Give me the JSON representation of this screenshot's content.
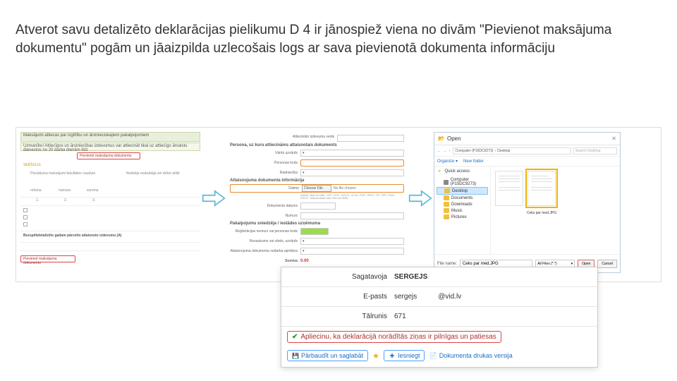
{
  "heading": "Atverot savu detalizēto deklarācijas pielikumu D 4 ir jānospiež viena no divām \"Pievienot maksājuma dokumentu\" pogām un jāaizpilda uzlecošais logs ar sava pievienotā dokumenta informāciju",
  "panel1": {
    "bar1": "Maksājumi attiecas par izglītību un ārstnieciskajiem pakalpojumiem",
    "bar2": "Uzmanību! Attiecīgos un ārstniecības izdevumus var attiecināt tikai uz attiecīgo ārvalstu dienestos no 20 darba dienām līdz",
    "redbox1": "Pievienot maksājuma dokumentu",
    "redbox2": "Pievienot maksājuma dokumentu",
    "rowhdr": "SERŠULIS",
    "cols": [
      "1.",
      "2.",
      "3."
    ],
    "lbl_pieliekami": "Piesiātuma maksājumi fakultātes naudula",
    "lbl_nedekamja": "Nodokļa maksātāja vel drīkst atlikt",
    "lbl_refuma": "refuma",
    "lbl_numura": "numura",
    "lbl_summa": "summa",
    "sec2": "Bezspēkdetalizēts gadam pārcelto attaisnoto izdevumu (A)"
  },
  "panel2": {
    "hdr_right": "Attiecināto izdevumu veids",
    "hdr1": "Persona, uz kuru attiecināms attaisnotais dokuments",
    "lbl_vards": "Vārds uzvārds",
    "lbl_pk": "Personas kods",
    "lbl_rad": "Radniecība",
    "hdr2": "Attaisnojuma dokumenta informācija",
    "lbl_date": "Datme",
    "choose": "Choose File",
    "nofile": "No file chosen",
    "hint": "Atļauto failu formāti: ODT, DOC, DOCX, XLSX, PDF, JPEG, TIF, TIFF, PNG, EDOC. Maksimālais failu lielums 5MB.",
    "lbl_dokdate": "Dokumenta datums",
    "lbl_num": "Numurs",
    "hdr3": "Pakalpojumu sniedzēja / iestādes uzņēmuma",
    "lbl_reg": "Reģistrācijas numurs vai personas kods",
    "lbl_name": "Nosaukums vai vārds, uzvārds",
    "lbl_sum": "Attaisnojuma dokumenta nodarba aprēķina",
    "lbl_summa": "Summa",
    "val_zero": "0.00",
    "outline_personas": true
  },
  "panel3": {
    "title": "Open",
    "crumb1": "Computer (P15DC9273)",
    "crumb2": "Desktop",
    "search_ph": "Search Desktop",
    "organize": "Organize ▾",
    "newfolder": "New folder",
    "sidebar": {
      "quick": "Quick access",
      "computer": "Computer (P15DC9273)",
      "desktop": "Desktop",
      "documents": "Documents",
      "downloads": "Downloads",
      "music": "Music",
      "pictures": "Pictures"
    },
    "file1": "",
    "file2": "Ceks par med.JPG",
    "footer_lbl": "File name:",
    "footer_val": "Ceks par med.JPG",
    "filter": "All Files (*.*)",
    "btn_open": "Open",
    "btn_cancel": "Cancel"
  },
  "overlay": {
    "lbl_sagatavoja": "Sagatavoja",
    "val_sagatavoja": "SERGEJS",
    "lbl_epasts": "E-pasts",
    "val_epasts1": "sergejs",
    "val_epasts2": "@vid.lv",
    "lbl_talrunis": "Tālrunis",
    "val_talrunis": "671",
    "confirm": "Apliecinu, ka deklarācijā norādītās ziņas ir pilnīgas un patiesas",
    "btn_parbaudit": "Pārbaudīt un saglabāt",
    "btn_iesniegt": "Iesniegt",
    "link_print": "Dokumenta drukas versija"
  },
  "icons": {
    "floppy": "💾",
    "submit": "✚",
    "print": "📄"
  }
}
